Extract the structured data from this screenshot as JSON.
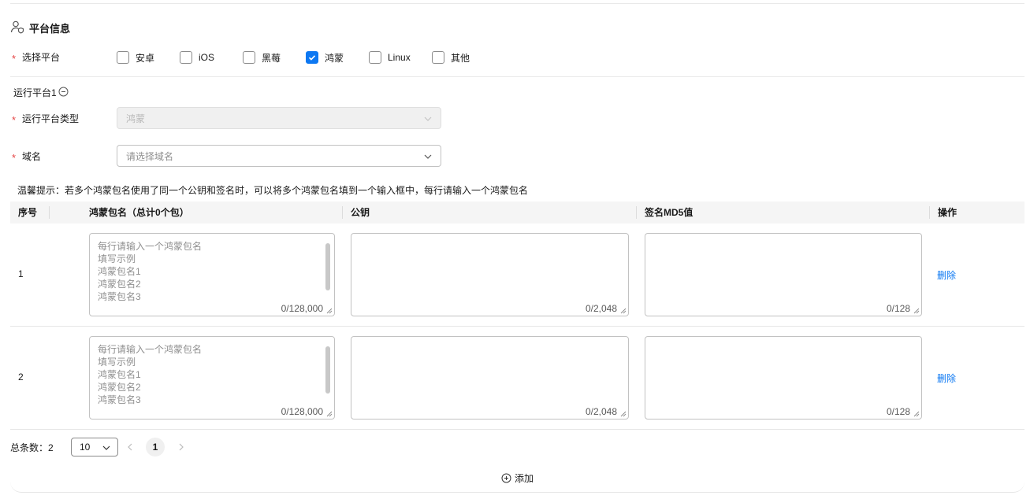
{
  "section": {
    "title": "平台信息",
    "icon": "user-shield-icon"
  },
  "platform_select": {
    "label": "选择平台",
    "required_mark": "*",
    "options": [
      {
        "label": "安卓",
        "checked": false
      },
      {
        "label": "iOS",
        "checked": false
      },
      {
        "label": "黑莓",
        "checked": false
      },
      {
        "label": "鸿蒙",
        "checked": true
      },
      {
        "label": "Linux",
        "checked": false
      },
      {
        "label": "其他",
        "checked": false
      }
    ]
  },
  "run_platform": {
    "title": "运行平台1",
    "type_label": "运行平台类型",
    "type_value": "鸿蒙",
    "domain_label": "域名",
    "domain_placeholder": "请选择域名"
  },
  "hint": "温馨提示：若多个鸿蒙包名使用了同一个公钥和签名时，可以将多个鸿蒙包名填到一个输入框中，每行请输入一个鸿蒙包名",
  "table": {
    "columns": {
      "index": "序号",
      "package": "鸿蒙包名",
      "package_count": "（总计0个包）",
      "pubkey": "公钥",
      "md5": "签名MD5值",
      "ops": "操作"
    },
    "rows": [
      {
        "index": "1",
        "package_placeholder": "每行请输入一个鸿蒙包名\n填写示例\n鸿蒙包名1\n鸿蒙包名2\n鸿蒙包名3",
        "package_count": "0/128,000",
        "pubkey_count": "0/2,048",
        "md5_count": "0/128",
        "delete": "删除"
      },
      {
        "index": "2",
        "package_placeholder": "每行请输入一个鸿蒙包名\n填写示例\n鸿蒙包名1\n鸿蒙包名2\n鸿蒙包名3",
        "package_count": "0/128,000",
        "pubkey_count": "0/2,048",
        "md5_count": "0/128",
        "delete": "删除"
      }
    ]
  },
  "pagination": {
    "total": "总条数：2",
    "page_size": "10",
    "current_page": "1"
  },
  "add_label": "添加",
  "colors": {
    "accent": "#0d78f2",
    "required": "#e54545"
  }
}
